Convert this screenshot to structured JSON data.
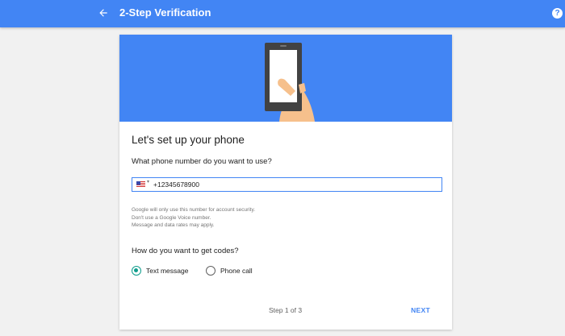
{
  "header": {
    "title": "2-Step Verification",
    "back_icon": "arrow-back-icon",
    "help_icon": "help-icon",
    "help_glyph": "?",
    "color": "#4285f4"
  },
  "card": {
    "illustration_icon": "phone-in-hand-illustration",
    "heading": "Let's set up your phone",
    "phone_question": "What phone number do you want to use?",
    "phone": {
      "country_flag_icon": "us-flag-icon",
      "dropdown_glyph": "▾",
      "value": "+12345678900"
    },
    "notes": [
      "Google will only use this number for account security.",
      "Don't use a Google Voice number.",
      "Message and data rates may apply."
    ],
    "codes_question": "How do you want to get codes?",
    "options": [
      {
        "label": "Text message",
        "selected": true
      },
      {
        "label": "Phone call",
        "selected": false
      }
    ],
    "step_text": "Step 1 of 3",
    "next_label": "NEXT"
  },
  "colors": {
    "accent": "#4285f4",
    "radio_selected": "#0f9d8c"
  }
}
